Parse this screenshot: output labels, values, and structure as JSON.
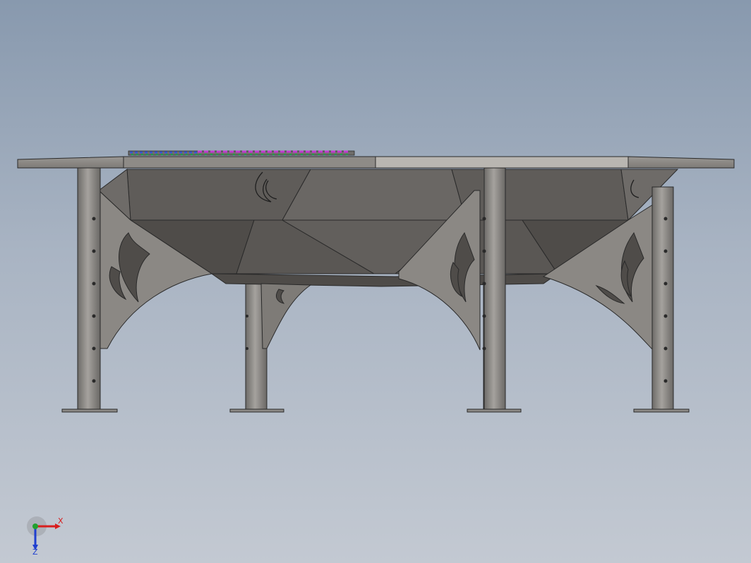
{
  "viewport": {
    "background_top": "#8899ae",
    "background_bottom": "#c3c9d2"
  },
  "model": {
    "part_color": "#8a8783",
    "shadow_color": "#55524f",
    "edge_color": "#2a2a2a",
    "grate_colors": [
      "#3a57c9",
      "#1f9e4a",
      "#c23ad1"
    ]
  },
  "triad": {
    "x_label": "X",
    "z_label": "Z",
    "x_color": "#d81e1e",
    "y_color": "#21a12e",
    "z_color": "#1f3fcf"
  }
}
